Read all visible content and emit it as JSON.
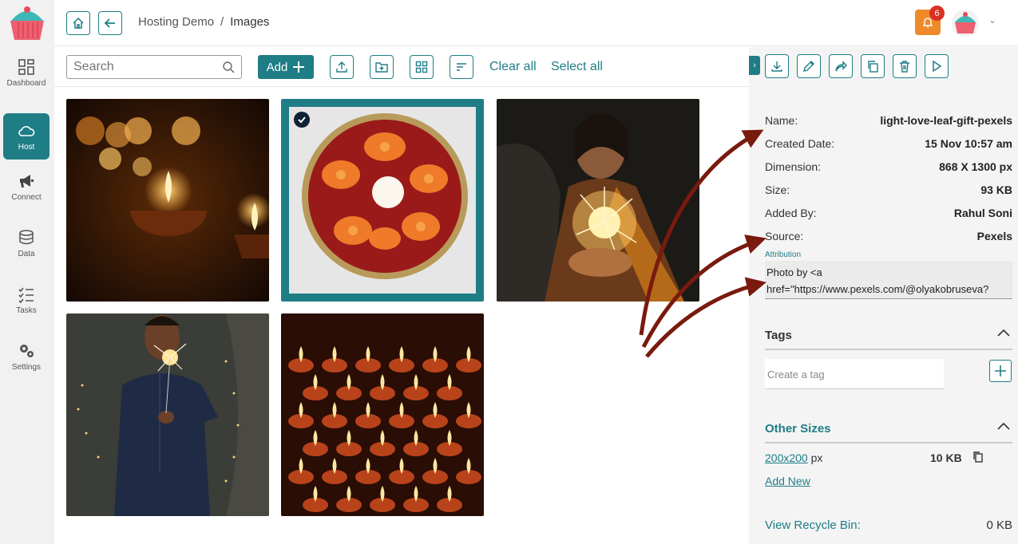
{
  "sidebar": {
    "items": [
      {
        "label": "Dashboard",
        "icon": "dashboard-grid-icon"
      },
      {
        "label": "Host",
        "icon": "cloud-icon",
        "active": true
      },
      {
        "label": "Connect",
        "icon": "megaphone-icon"
      },
      {
        "label": "Data",
        "icon": "database-icon"
      },
      {
        "label": "Tasks",
        "icon": "checklist-icon"
      },
      {
        "label": "Settings",
        "icon": "gears-icon"
      }
    ]
  },
  "header": {
    "breadcrumb": [
      "Hosting Demo",
      "Images"
    ],
    "separator": "/",
    "notifications": "6"
  },
  "toolbar": {
    "search_placeholder": "Search",
    "add_label": "Add",
    "clear_all": "Clear all",
    "select_all": "Select all"
  },
  "gallery": {
    "images": [
      {
        "alt": "diya candles",
        "selected": false
      },
      {
        "alt": "flower bowl",
        "selected": true
      },
      {
        "alt": "woman with sparklers",
        "selected": false
      },
      {
        "alt": "man with sparkler",
        "selected": false
      },
      {
        "alt": "oil lamps",
        "selected": false
      }
    ]
  },
  "details": {
    "name_label": "Name:",
    "name": "light-love-leaf-gift-pexels",
    "created_label": "Created Date:",
    "created": "15 Nov 10:57 am",
    "dimension_label": "Dimension:",
    "dimension": "868 X 1300 px",
    "size_label": "Size:",
    "size": "93 KB",
    "added_by_label": "Added By:",
    "added_by": "Rahul Soni",
    "source_label": "Source:",
    "source": "Pexels",
    "attribution_label": "Attribution",
    "attribution_line1": "Photo by <a",
    "attribution_line2": "href=\"https://www.pexels.com/@olyakobruseva?"
  },
  "tags": {
    "title": "Tags",
    "placeholder": "Create a tag"
  },
  "other_sizes": {
    "title": "Other Sizes",
    "size_link": "200x200",
    "size_unit": "px",
    "size_value": "10 KB",
    "add_new": "Add New"
  },
  "recycle": {
    "label": "View Recycle Bin:",
    "value": "0 KB"
  },
  "colors": {
    "accent": "#1f7d86",
    "notification": "#ef8a2a",
    "annotation_arrow": "#7a1a0e"
  }
}
